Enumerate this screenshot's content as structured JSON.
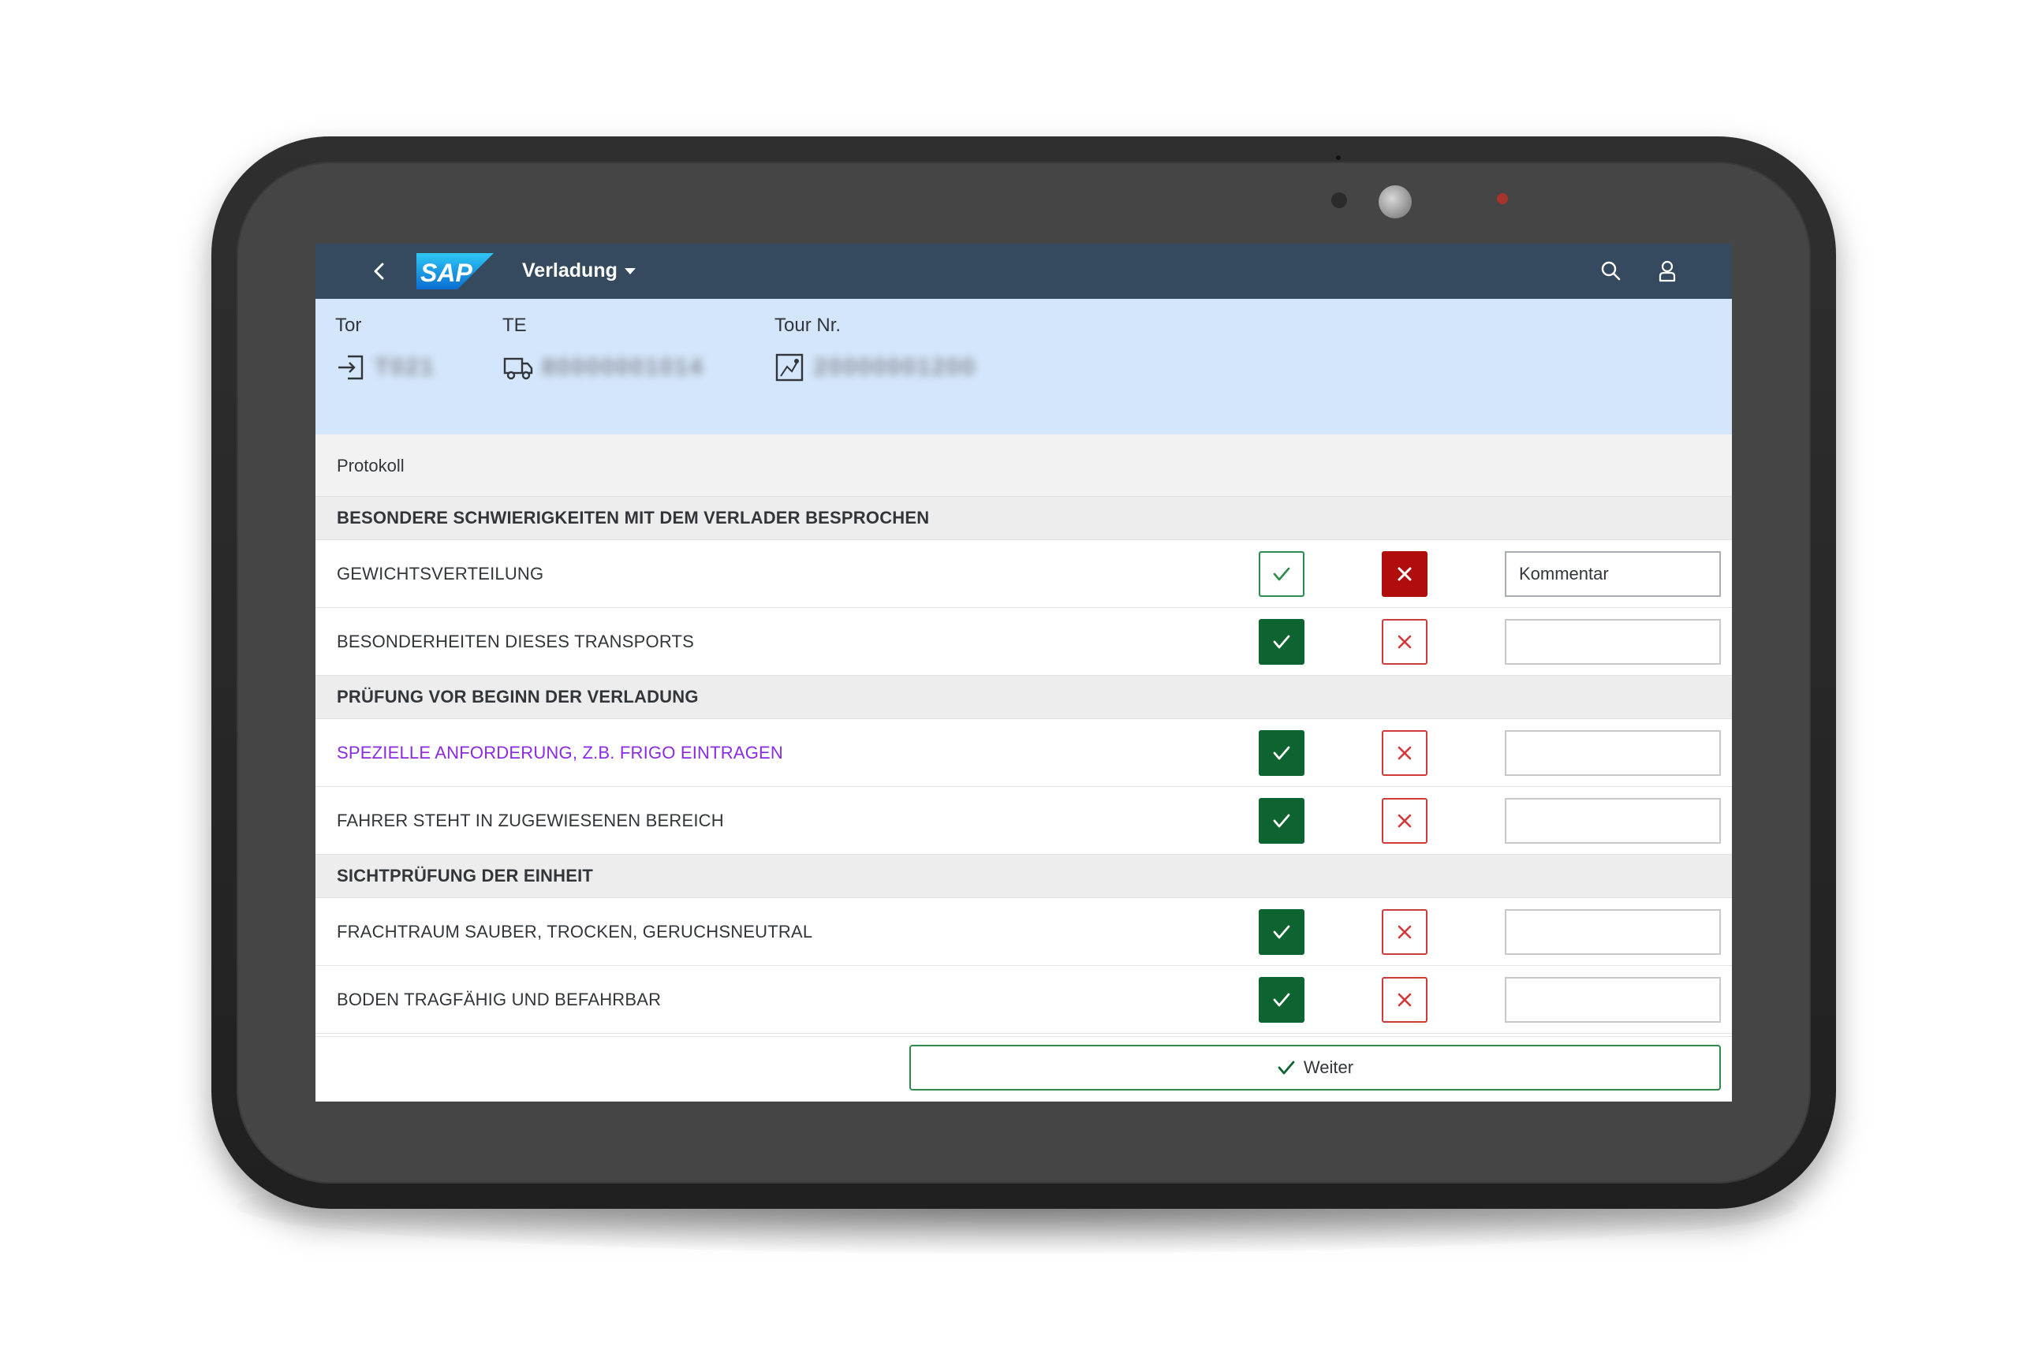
{
  "shell": {
    "app_title": "Verladung",
    "logo_text": "SAP"
  },
  "header": {
    "attributes": [
      {
        "label": "Tor",
        "value": "T021"
      },
      {
        "label": "TE",
        "value": "80000001014"
      },
      {
        "label": "Tour Nr.",
        "value": "20000001200"
      }
    ]
  },
  "protokoll": {
    "title": "Protokoll"
  },
  "groups": [
    {
      "title": "BESONDERE SCHWIERIGKEITEN MIT DEM VERLADER BESPROCHEN",
      "items": [
        {
          "label": "GEWICHTSVERTEILUNG",
          "status": "rejected",
          "comment": "Kommentar"
        },
        {
          "label": "BESONDERHEITEN DIESES TRANSPORTS",
          "status": "accepted",
          "comment": ""
        }
      ]
    },
    {
      "title": "PRÜFUNG VOR BEGINN DER VERLADUNG",
      "items": [
        {
          "label": "SPEZIELLE ANFORDERUNG, Z.B. FRIGO EINTRAGEN",
          "status": "accepted",
          "comment": ""
        },
        {
          "label": "FAHRER STEHT IN ZUGEWIESENEN BEREICH",
          "status": "accepted",
          "comment": ""
        }
      ]
    },
    {
      "title": "SICHTPRÜFUNG DER EINHEIT",
      "items": [
        {
          "label": "FRACHTRAUM SAUBER, TROCKEN, GERUCHSNEUTRAL",
          "status": "accepted",
          "comment": ""
        },
        {
          "label": "BODEN TRAGFÄHIG UND BEFAHRBAR",
          "status": "accepted",
          "comment": ""
        }
      ]
    }
  ],
  "footer": {
    "weiter_label": "Weiter"
  },
  "colors": {
    "shell_bg": "#354a5f",
    "header_bg": "#d4e6fb",
    "accept_green": "#0e6431",
    "reject_red": "#b00d0d",
    "link_purple": "#8a2be2"
  }
}
